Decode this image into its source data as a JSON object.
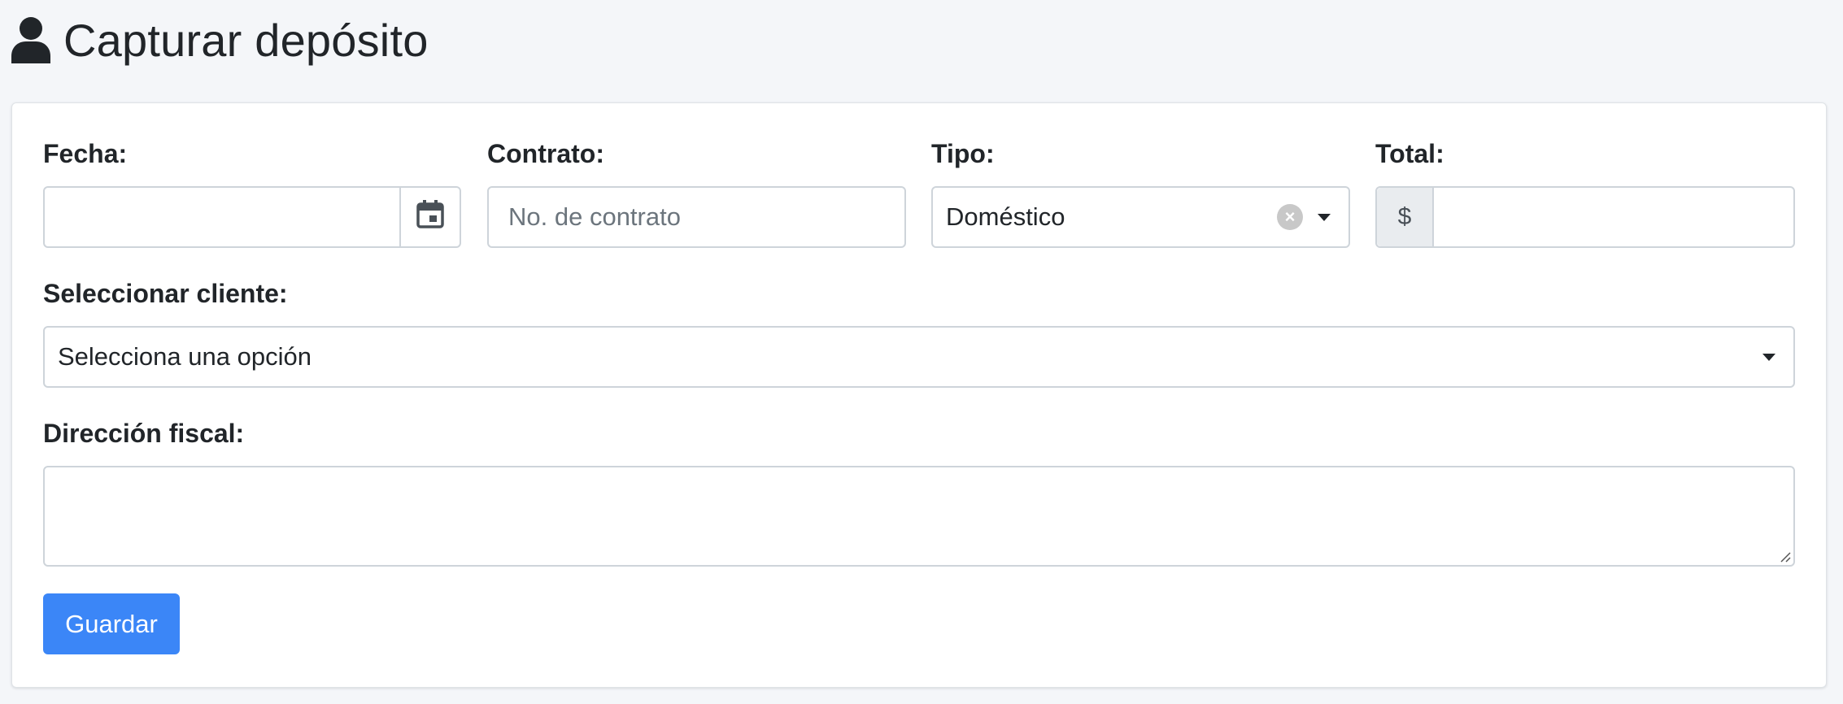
{
  "header": {
    "title": "Capturar depósito",
    "icon": "user-icon"
  },
  "form": {
    "fecha": {
      "label": "Fecha:",
      "value": "",
      "icon": "calendar-icon"
    },
    "contrato": {
      "label": "Contrato:",
      "placeholder": "No. de contrato",
      "value": ""
    },
    "tipo": {
      "label": "Tipo:",
      "selected": "Doméstico",
      "clear_icon": "clear-icon",
      "caret_icon": "chevron-down-icon"
    },
    "total": {
      "label": "Total:",
      "prefix": "$",
      "value": ""
    },
    "cliente": {
      "label": "Seleccionar cliente:",
      "placeholder": "Selecciona una opción",
      "caret_icon": "chevron-down-icon"
    },
    "direccion": {
      "label": "Dirección fiscal:",
      "value": ""
    },
    "submit_label": "Guardar"
  },
  "colors": {
    "page_background": "#f4f6f9",
    "card_background": "#ffffff",
    "primary": "#3b86f7",
    "border": "#ced4da",
    "addon_background": "#e9ecef"
  }
}
